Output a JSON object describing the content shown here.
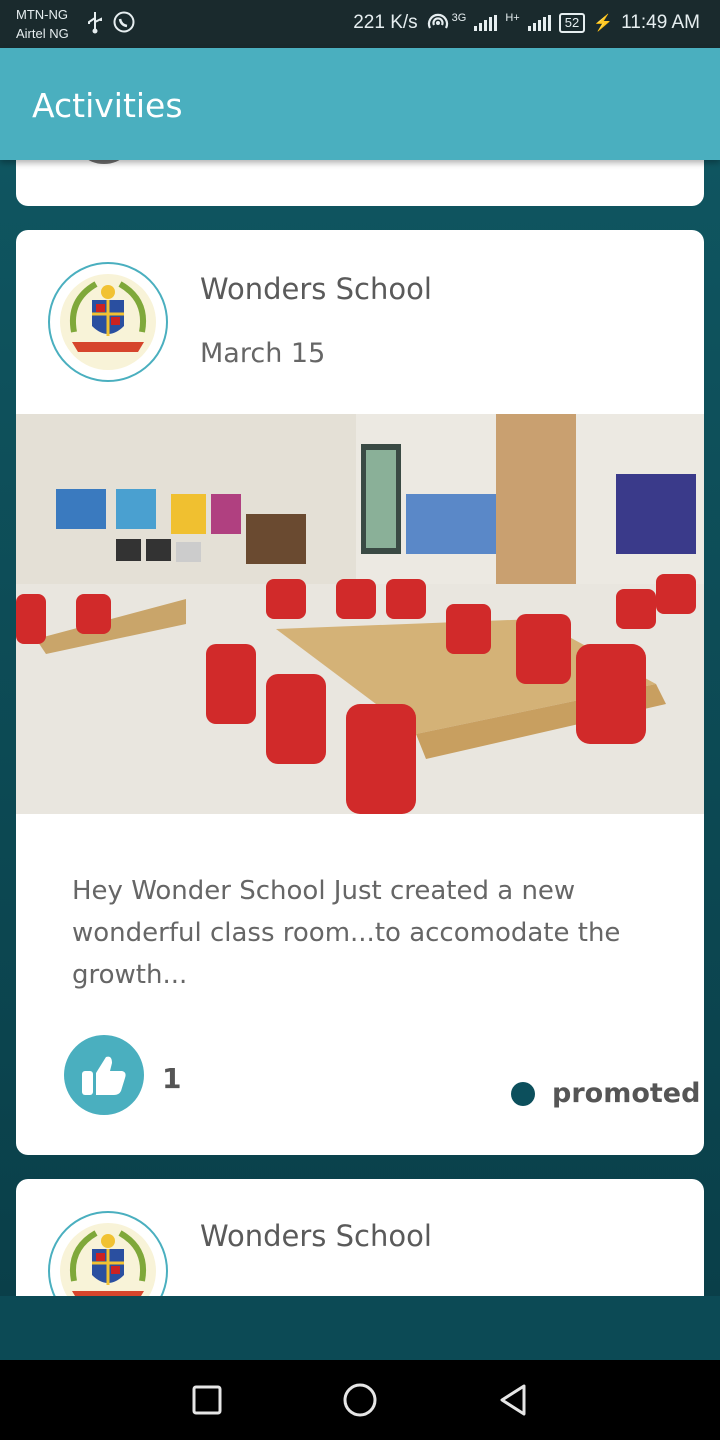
{
  "status_bar": {
    "carrier1": "MTN-NG",
    "carrier2": "Airtel NG",
    "net_speed": "221 K/s",
    "net_type": "3G",
    "net_type2": "H+",
    "battery": "52",
    "time": "11:49 AM"
  },
  "app_bar": {
    "title": "Activities"
  },
  "posts": [
    {
      "school": "Wonders School",
      "date": "March 15",
      "text": "Hey Wonder School Just created a new wonderful class room...to accomodate the growth...",
      "likes": "1",
      "tag": "promoted"
    },
    {
      "school": "Wonders School"
    }
  ],
  "colors": {
    "accent": "#4aafbf",
    "background": "#0c4a55",
    "promo_dot": "#0c4f5c"
  },
  "icons": [
    "usb-icon",
    "whatsapp-icon",
    "hotspot-icon",
    "signal-icon",
    "battery-icon",
    "thumbs-up-icon",
    "square-icon",
    "circle-icon",
    "back-triangle-icon"
  ]
}
